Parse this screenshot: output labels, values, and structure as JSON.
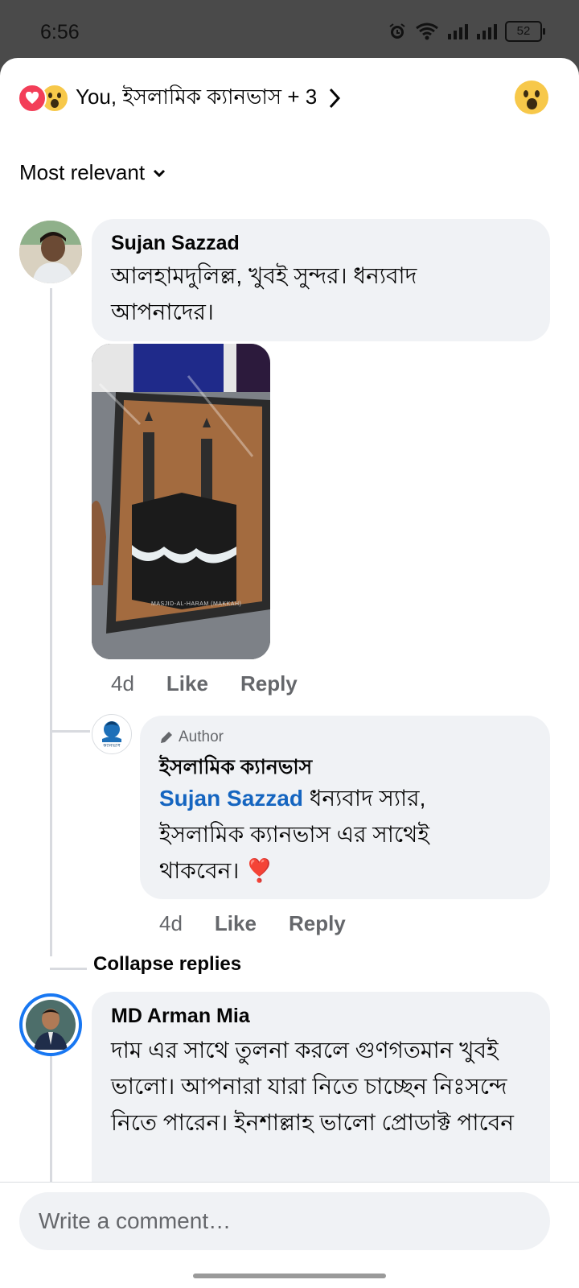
{
  "status_bar": {
    "time": "6:56",
    "battery": "52"
  },
  "reactions": {
    "summary": "You, ইসলামিক ক্যানভাস + 3"
  },
  "sort": {
    "label": "Most relevant"
  },
  "comments": [
    {
      "author": "Sujan Sazzad",
      "text": "আলহামদুলিল্ল, খুবই সুন্দর।  ধন্যবাদ আপনাদের।",
      "image_caption": "MASJID-AL-HARAM (MAKKAH)",
      "time": "4d",
      "like": "Like",
      "reply": "Reply",
      "replies": [
        {
          "badge": "Author",
          "author": "ইসলামিক ক্যানভাস",
          "avatar_label": "ক্যানভাস",
          "mention": "Sujan Sazzad",
          "text": " ধন্যবাদ স্যার, ইসলামিক ক্যানভাস এর সাথেই থাকবেন। ❣️",
          "time": "4d",
          "like": "Like",
          "reply": "Reply"
        }
      ],
      "collapse_label": "Collapse replies"
    },
    {
      "author": "MD Arman Mia",
      "text": "দাম এর সাথে তুলনা করলে গুণগতমান খুবই ভালো। আপনারা যারা নিতে চাচ্ছেন নিঃসন্দে নিতে পারেন।  ইনশাল্লাহ ভালো প্রোডাক্ট পাবেন"
    }
  ],
  "composer": {
    "placeholder": "Write a comment…"
  }
}
